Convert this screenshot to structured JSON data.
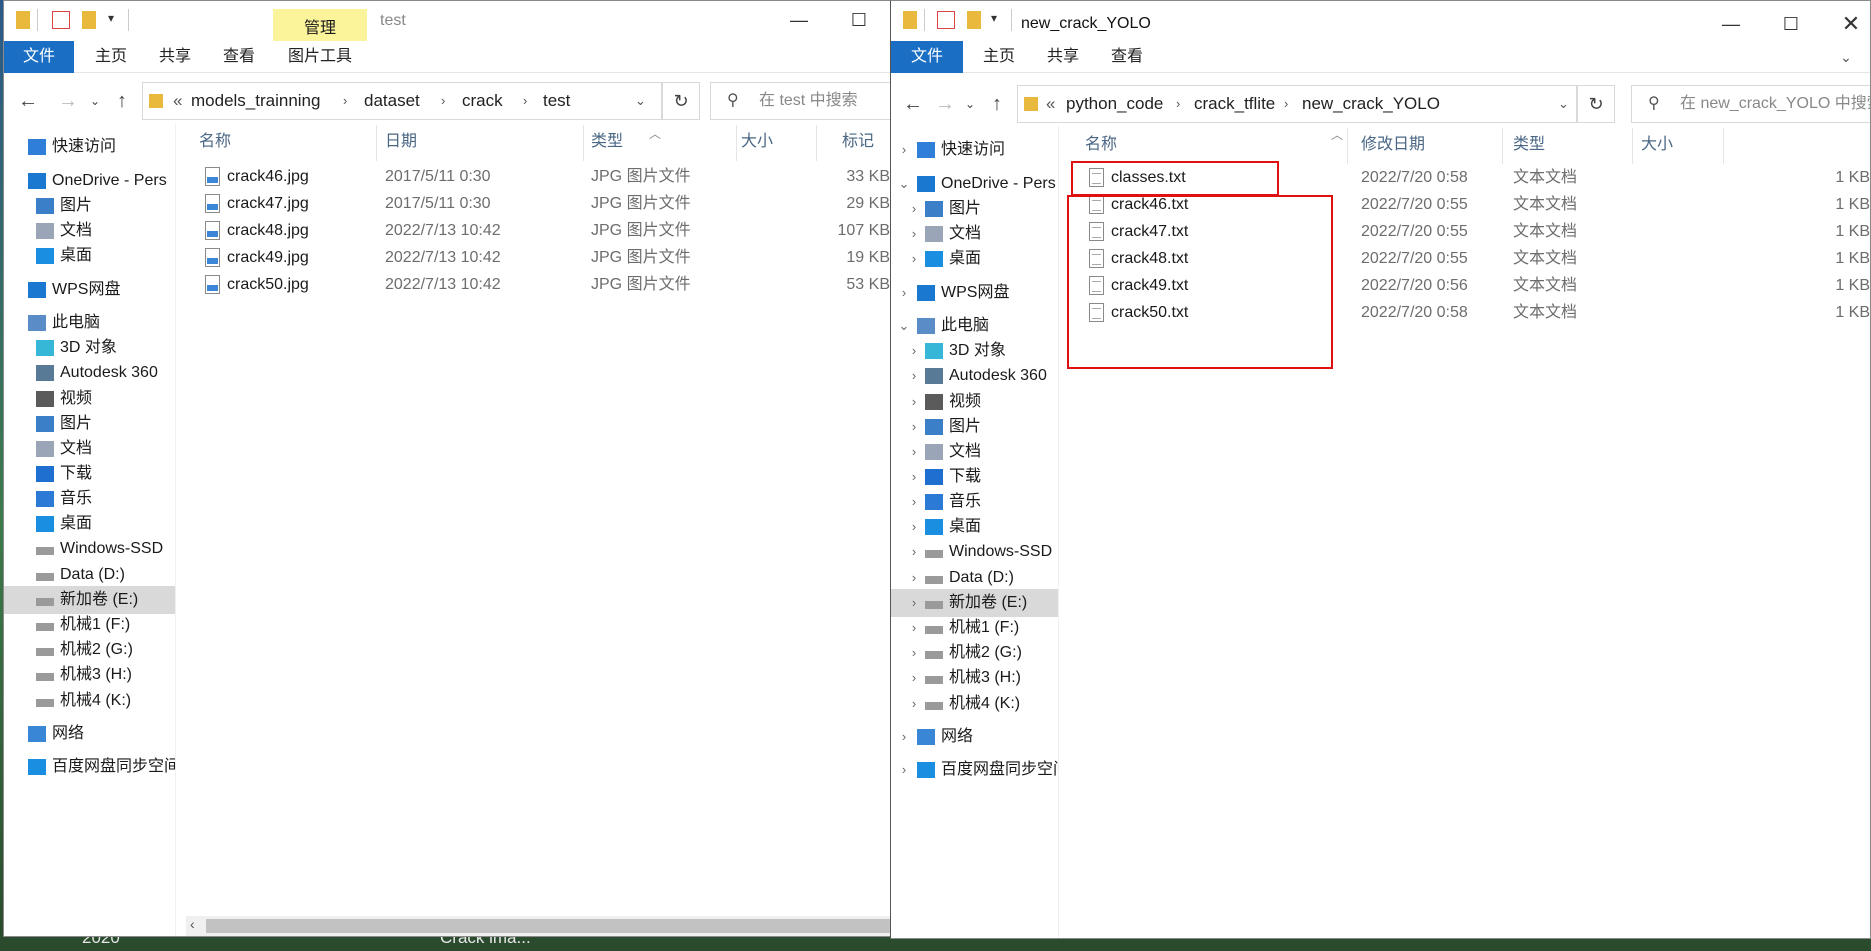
{
  "colors": {
    "accent": "#1a6fc4",
    "context_tab": "#fbf49a",
    "highlight": "#e01010"
  },
  "desktop": {
    "labels": [
      "2020",
      "Crack ima..."
    ]
  },
  "left": {
    "title": "test",
    "context_group": "管理",
    "tabs": [
      "文件",
      "主页",
      "共享",
      "查看",
      "图片工具"
    ],
    "breadcrumb": [
      "«",
      "models_trainning",
      "dataset",
      "crack",
      "test"
    ],
    "search_placeholder": "在 test 中搜索",
    "columns": [
      "名称",
      "日期",
      "类型",
      "大小",
      "标记"
    ],
    "files": [
      {
        "name": "crack46.jpg",
        "date": "2017/5/11 0:30",
        "type": "JPG 图片文件",
        "size": "33 KB"
      },
      {
        "name": "crack47.jpg",
        "date": "2017/5/11 0:30",
        "type": "JPG 图片文件",
        "size": "29 KB"
      },
      {
        "name": "crack48.jpg",
        "date": "2022/7/13 10:42",
        "type": "JPG 图片文件",
        "size": "107 KB"
      },
      {
        "name": "crack49.jpg",
        "date": "2022/7/13 10:42",
        "type": "JPG 图片文件",
        "size": "19 KB"
      },
      {
        "name": "crack50.jpg",
        "date": "2022/7/13 10:42",
        "type": "JPG 图片文件",
        "size": "53 KB"
      }
    ],
    "sidebar": [
      "快速访问",
      "OneDrive - Pers",
      "图片",
      "文档",
      "桌面",
      "WPS网盘",
      "此电脑",
      "3D 对象",
      "Autodesk 360",
      "视频",
      "图片",
      "文档",
      "下载",
      "音乐",
      "桌面",
      "Windows-SSD",
      "Data (D:)",
      "新加卷 (E:)",
      "机械1 (F:)",
      "机械2 (G:)",
      "机械3 (H:)",
      "机械4 (K:)",
      "网络",
      "百度网盘同步空间"
    ]
  },
  "right": {
    "title": "new_crack_YOLO",
    "tabs": [
      "文件",
      "主页",
      "共享",
      "查看"
    ],
    "breadcrumb": [
      "«",
      "python_code",
      "crack_tflite",
      "new_crack_YOLO"
    ],
    "search_placeholder": "在 new_crack_YOLO 中搜索",
    "columns": [
      "名称",
      "修改日期",
      "类型",
      "大小"
    ],
    "files": [
      {
        "name": "classes.txt",
        "date": "2022/7/20 0:58",
        "type": "文本文档",
        "size": "1 KB"
      },
      {
        "name": "crack46.txt",
        "date": "2022/7/20 0:55",
        "type": "文本文档",
        "size": "1 KB"
      },
      {
        "name": "crack47.txt",
        "date": "2022/7/20 0:55",
        "type": "文本文档",
        "size": "1 KB"
      },
      {
        "name": "crack48.txt",
        "date": "2022/7/20 0:55",
        "type": "文本文档",
        "size": "1 KB"
      },
      {
        "name": "crack49.txt",
        "date": "2022/7/20 0:56",
        "type": "文本文档",
        "size": "1 KB"
      },
      {
        "name": "crack50.txt",
        "date": "2022/7/20 0:58",
        "type": "文本文档",
        "size": "1 KB"
      }
    ],
    "sidebar": [
      "快速访问",
      "OneDrive - Pers",
      "图片",
      "文档",
      "桌面",
      "WPS网盘",
      "此电脑",
      "3D 对象",
      "Autodesk 360",
      "视频",
      "图片",
      "文档",
      "下载",
      "音乐",
      "桌面",
      "Windows-SSD",
      "Data (D:)",
      "新加卷 (E:)",
      "机械1 (F:)",
      "机械2 (G:)",
      "机械3 (H:)",
      "机械4 (K:)",
      "网络",
      "百度网盘同步空间"
    ]
  }
}
